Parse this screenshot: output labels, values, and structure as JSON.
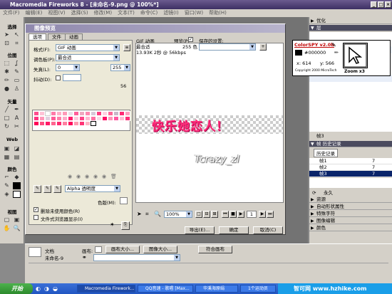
{
  "app": {
    "title": "Macromedia Fireworks 8 - [未命名-9.png @ 100%*]",
    "menus": [
      "文件(F)",
      "编辑(E)",
      "视图(V)",
      "选择(S)",
      "修改(M)",
      "文本(T)",
      "命令(C)",
      "滤镜(I)",
      "窗口(W)",
      "帮助(H)"
    ]
  },
  "tools": {
    "sections": [
      "选择",
      "位图",
      "矢量",
      "Web",
      "颜色",
      "视图"
    ]
  },
  "right_panel": {
    "optimize": "优化",
    "layers": "层",
    "frames_label": "帧3",
    "history_header": "帧 历史记录",
    "history_tab": "历史记录",
    "frames": [
      {
        "label": "帧1",
        "value": "7"
      },
      {
        "label": "帧2",
        "value": "7"
      },
      {
        "label": "帧3",
        "value": "7"
      }
    ],
    "forever": "永久",
    "collapsed": [
      "资源",
      "自动形状属性",
      "特殊字符",
      "图像编辑",
      "颜色"
    ]
  },
  "colorspy": {
    "title": "ColorSPY v2.0b",
    "hex": "#000000",
    "x": "x: 614",
    "y": "y: 566",
    "copyright": "Copyright 2000 MicroTech",
    "zoom": "Zoom x3",
    "swatch_color": "#000000",
    "accent": "#c00000"
  },
  "dialog": {
    "title": "图像预览",
    "tabs": [
      "选项",
      "文件",
      "动画"
    ],
    "format_label": "格式(F):",
    "format_value": "GIF 动画",
    "palette_label": "调色板(P):",
    "palette_value": "最合适",
    "loss_label": "失真(L):",
    "loss_value": "0",
    "colors_value": "255",
    "dither_label": "抖动(D):",
    "dither_pct": "",
    "dither_count": "56",
    "transparency_value": "Alpha 透明度",
    "matte_label": "色版(M):",
    "remove_unused_label": "删除未使用颜色(R)",
    "browser_preview_label": "文件式浏览器显示(I)",
    "preview_info": [
      "GIF 动画",
      "最合适",
      "13.93K 2秒 @ 56kbps"
    ],
    "preview_checkbox_label": "预览(P)",
    "preview_colors": "255 色",
    "saved_settings_label": "保存的设置:",
    "preview_text": "快乐她恋人！",
    "watermark_text": "Tcrazy_zl",
    "zoom_value": "100%",
    "frame_counter": "1",
    "buttons": {
      "export": "导出(E)...",
      "ok": "确定",
      "cancel": "取消(C)"
    }
  },
  "props": {
    "doc_label": "文档",
    "doc_name": "未命名-9",
    "canvas_label": "画布:",
    "canvas_size": "画布大小...",
    "image_size": "图像大小...",
    "fit_canvas": "符合画布"
  },
  "taskbar": {
    "start": "开始",
    "tasks": [
      "Macromedia Firework...",
      "QQ音速 - 歌唱 [Max...",
      "华溪海原绢",
      "1个运动员"
    ],
    "watermark": "智可网 www.hzhike.com"
  }
}
